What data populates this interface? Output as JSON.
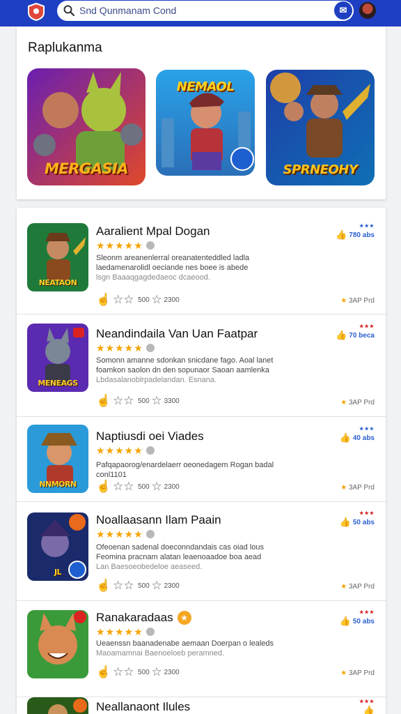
{
  "search": {
    "query": "Snd Qunmanam Cond"
  },
  "featured": {
    "title": "Raplukanma",
    "tiles": [
      {
        "label": "MERGASIA"
      },
      {
        "label": "NEMAOL"
      },
      {
        "label": "SPRNEOHY"
      }
    ]
  },
  "apps": [
    {
      "name": "Aaralient Mpal Dogan",
      "stars": "★★★★★",
      "desc": "Sleonm areanenlerral oreanatenteddled ladla laedamenarolidl oeciande nes boee is abede",
      "desc_muted": "lsgn Baaaqgagdedaeoc dcaeood.",
      "action_a": "500",
      "action_b": "2300",
      "likes": "780 abs",
      "rating": "3AP Prd",
      "icon_label": "NEATAON"
    },
    {
      "name": "Neandindaila Van Uan Faatpar",
      "stars": "★★★★★",
      "desc": "Somonn amanne sdonkan snicdane fago. Aoal lanet foamkon saolon dn den sopunaor Saoan aamlenka",
      "desc_muted": "Lbdasalanoblrpadelandan. Esnana.",
      "action_a": "500",
      "action_b": "3300",
      "likes": "70 beca",
      "rating": "3AP Prd",
      "icon_label": "MENEAGS"
    },
    {
      "name": "Naptiusdi oei Viades",
      "stars": "★★★★★",
      "desc": "Pafqapaorog/enardelaerr oeonedagem Rogan badal conl1101",
      "desc_muted": "",
      "action_a": "500",
      "action_b": "2300",
      "likes": "40 abs",
      "rating": "3AP Prd",
      "icon_label": "NNMORN"
    },
    {
      "name": "Noallaasann Ilam Paain",
      "stars": "★★★★★",
      "desc": "Ofeoenan sadenal doeconndandais cas oiad lous Feomina pracnam alatan leaenoaadoe boa aead",
      "desc_muted": "Lan Baesoeobedeloe aeaseed.",
      "action_a": "500",
      "action_b": "2300",
      "likes": "50 abs",
      "rating": "3AP Prd",
      "icon_label": "JL"
    },
    {
      "name": "Ranakaradaas",
      "stars": "★★★★★",
      "desc": "Ueaenssn baanadenabe aemaan Doerpan o lealeds",
      "desc_muted": "Maoamamnai Baenoeloeb peramned.",
      "action_a": "500",
      "action_b": "2300",
      "likes": "50 abs",
      "rating": "3AP Prd",
      "icon_label": ""
    },
    {
      "name": "Neallanaont Ilules",
      "stars": "",
      "desc": "",
      "desc_muted": "",
      "action_a": "",
      "action_b": "",
      "likes": "",
      "rating": "",
      "icon_label": ""
    }
  ],
  "colors": {
    "topbar": "#1f3fc2",
    "star": "#f4a400",
    "like": "#2b5fd1",
    "accent_red": "#d32222"
  },
  "icons": [
    "logo-icon",
    "search-icon",
    "mic-icon",
    "thumb-icon",
    "star-icon",
    "info-icon",
    "badge-icon"
  ]
}
